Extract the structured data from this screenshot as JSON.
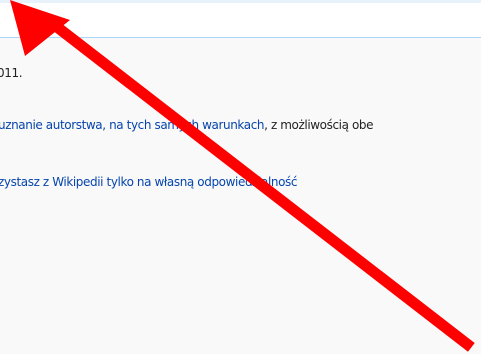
{
  "footer": {
    "last_modified_fragment": "011.",
    "license_link": "uznanie autorstwa, na tych samych warunkach",
    "license_rest": ", z możliwością obe",
    "disclaimer_link": "zystasz z Wikipedii tylko na własną odpowiedzialność"
  },
  "annotation": {
    "arrow_color": "#ff0000",
    "arrow_icon": "red-arrow-icon"
  }
}
